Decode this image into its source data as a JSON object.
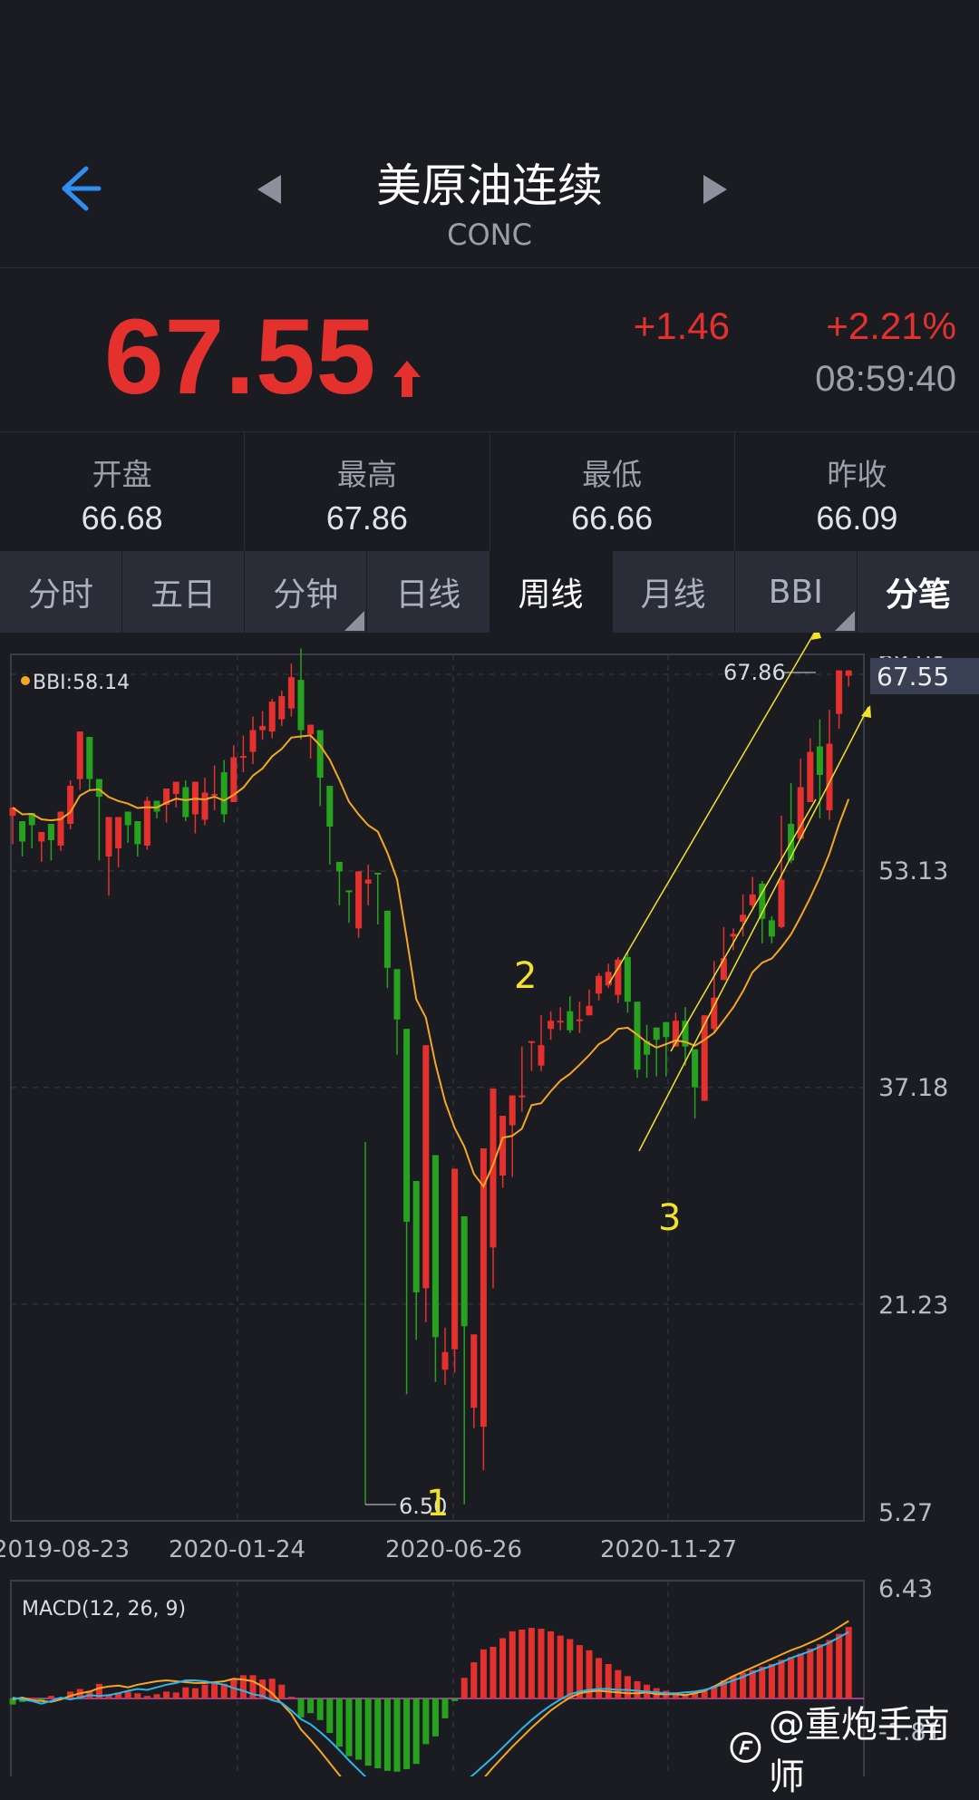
{
  "header": {
    "title": "美原油连续",
    "code": "CONC"
  },
  "quote": {
    "price": "67.55",
    "change": "+1.46",
    "change_pct": "+2.21%",
    "time": "08:59:40"
  },
  "stats": [
    {
      "label": "开盘",
      "value": "66.68"
    },
    {
      "label": "最高",
      "value": "67.86"
    },
    {
      "label": "最低",
      "value": "66.66"
    },
    {
      "label": "昨收",
      "value": "66.09"
    }
  ],
  "tabs": [
    {
      "label": "分时"
    },
    {
      "label": "五日"
    },
    {
      "label": "分钟"
    },
    {
      "label": "日线"
    },
    {
      "label": "周线"
    },
    {
      "label": "月线"
    },
    {
      "label": "BBI"
    },
    {
      "label": "分笔"
    }
  ],
  "colors": {
    "up": "#e5312e",
    "down": "#27a21f",
    "bbi": "#f5a623",
    "background": "#1b1c21"
  },
  "chart_data": [
    {
      "type": "candlestick",
      "indicator_label": "BBI:58.14",
      "y_ticks": [
        "53.13",
        "37.18",
        "21.23",
        "5.27"
      ],
      "y_top_partial": "69.08",
      "ylim": [
        5.27,
        69.08
      ],
      "current_price_tag": "67.55",
      "high_marker": "67.86",
      "low_marker": "6.50",
      "x_ticks": [
        "2019-08-23",
        "2020-01-24",
        "2020-06-26",
        "2020-11-27"
      ],
      "annotations": [
        "1",
        "2",
        "3"
      ],
      "candles": [
        [
          57.2,
          57.8,
          55.4,
          55.1,
          0
        ],
        [
          55.3,
          56.8,
          56.6,
          54.2,
          1
        ],
        [
          56.5,
          57.4,
          55.2,
          54.8,
          1
        ],
        [
          55.3,
          56.0,
          55.4,
          53.8,
          0
        ],
        [
          55.4,
          56.6,
          54.9,
          53.9,
          1
        ],
        [
          55.0,
          57.5,
          56.6,
          54.6,
          0
        ],
        [
          56.6,
          59.4,
          59.8,
          56.2,
          0
        ],
        [
          59.9,
          63.4,
          63.4,
          59.1,
          0
        ],
        [
          63.0,
          59.9,
          58.3,
          59.0,
          1
        ],
        [
          59.9,
          58.6,
          54.1,
          53.9,
          1
        ],
        [
          54.2,
          57.1,
          52.7,
          51.3,
          0
        ],
        [
          54.8,
          57.1,
          52.1,
          53.4,
          0
        ],
        [
          56.5,
          57.5,
          54.3,
          55.2,
          1
        ],
        [
          55.1,
          56.8,
          54.5,
          54.2,
          1
        ],
        [
          55.0,
          58.3,
          58.6,
          54.7,
          0
        ],
        [
          58.3,
          57.5,
          58.2,
          57.0,
          1
        ],
        [
          58.0,
          59.2,
          57.2,
          56.7,
          0
        ],
        [
          58.8,
          59.7,
          59.4,
          57.8,
          0
        ],
        [
          59.3,
          57.1,
          59.8,
          56.8,
          1
        ],
        [
          57.3,
          59.7,
          56.6,
          55.9,
          0
        ],
        [
          56.9,
          58.9,
          60.0,
          56.5,
          0
        ],
        [
          58.8,
          58.8,
          60.9,
          57.6,
          0
        ],
        [
          60.4,
          57.3,
          61.3,
          56.7,
          1
        ],
        [
          58.2,
          61.5,
          62.4,
          58.2,
          0
        ],
        [
          61.6,
          61.5,
          63.1,
          60.4,
          0
        ],
        [
          61.9,
          63.5,
          64.5,
          61.0,
          0
        ],
        [
          63.8,
          63.5,
          64.9,
          62.8,
          0
        ],
        [
          63.4,
          65.6,
          65.8,
          62.9,
          0
        ],
        [
          66.0,
          64.3,
          66.4,
          63.8,
          0
        ],
        [
          65.1,
          67.4,
          68.4,
          64.5,
          0
        ],
        [
          67.2,
          63.5,
          69.5,
          62.8,
          1
        ],
        [
          63.2,
          63.9,
          61.2,
          61.4,
          0
        ],
        [
          63.5,
          60.0,
          59.8,
          57.9,
          1
        ],
        [
          59.4,
          56.4,
          54.0,
          53.6,
          1
        ],
        [
          53.8,
          53.1,
          51.2,
          50.6,
          1
        ],
        [
          51.6,
          51.7,
          49.3,
          49.3,
          1
        ],
        [
          48.9,
          53.1,
          51.9,
          48.2,
          0
        ],
        [
          52.2,
          52.5,
          53.6,
          50.6,
          0
        ],
        [
          53.0,
          52.9,
          50.5,
          49.2,
          1
        ],
        [
          50.2,
          46.0,
          45.8,
          44.5,
          1
        ],
        [
          45.9,
          42.2,
          40.0,
          39.6,
          1
        ],
        [
          41.5,
          27.3,
          30.6,
          14.6,
          1
        ],
        [
          30.3,
          22.1,
          22.2,
          18.6,
          1
        ],
        [
          22.4,
          40.3,
          35.2,
          19.9,
          0
        ],
        [
          32.2,
          18.8,
          17.8,
          15.5,
          1
        ],
        [
          16.4,
          17.7,
          19.5,
          15.3,
          0
        ],
        [
          17.9,
          31.2,
          28.6,
          16.2,
          0
        ],
        [
          27.7,
          19.6,
          17.5,
          6.5,
          1
        ],
        [
          19.0,
          13.6,
          12.0,
          12.1,
          0
        ],
        [
          12.2,
          32.7,
          26.3,
          9.0,
          0
        ],
        [
          25.4,
          37.1,
          31.1,
          22.4,
          0
        ],
        [
          30.7,
          35.1,
          34.2,
          29.8,
          0
        ],
        [
          34.4,
          36.6,
          36.6,
          30.6,
          0
        ],
        [
          36.6,
          36.5,
          40.2,
          35.4,
          0
        ],
        [
          40.5,
          40.6,
          40.0,
          38.4,
          0
        ],
        [
          40.3,
          38.8,
          42.5,
          38.4,
          0
        ],
        [
          42.1,
          41.5,
          42.8,
          40.7,
          0
        ],
        [
          42.1,
          42.1,
          43.1,
          41.4,
          0
        ],
        [
          42.8,
          41.4,
          43.9,
          41.2,
          1
        ],
        [
          42.1,
          42.2,
          43.5,
          41.2,
          0
        ],
        [
          42.5,
          43.2,
          44.4,
          42.8,
          0
        ],
        [
          44.1,
          45.4,
          45.6,
          43.6,
          0
        ],
        [
          45.7,
          44.7,
          46.3,
          44.5,
          0
        ],
        [
          44.0,
          46.6,
          46.8,
          43.4,
          0
        ],
        [
          46.8,
          43.5,
          47.2,
          42.7,
          1
        ],
        [
          43.5,
          38.5,
          40.6,
          37.9,
          1
        ],
        [
          40.6,
          39.6,
          41.8,
          37.9,
          1
        ],
        [
          41.6,
          40.7,
          41.4,
          38.0,
          1
        ],
        [
          42.0,
          40.9,
          40.5,
          38.0,
          1
        ],
        [
          40.2,
          42.1,
          42.7,
          40.3,
          0
        ],
        [
          42.1,
          40.2,
          43.1,
          38.8,
          1
        ],
        [
          40.0,
          37.2,
          36.8,
          34.9,
          1
        ],
        [
          36.2,
          42.5,
          40.8,
          36.7,
          0
        ],
        [
          41.5,
          43.8,
          46.5,
          41.2,
          0
        ],
        [
          46.7,
          45.1,
          49.0,
          45.7,
          0
        ],
        [
          48.3,
          48.5,
          48.9,
          47.3,
          0
        ],
        [
          49.4,
          49.9,
          51.4,
          48.3,
          0
        ],
        [
          51.4,
          50.6,
          52.7,
          50.4,
          0
        ],
        [
          52.2,
          49.6,
          52.4,
          47.8,
          1
        ],
        [
          49.5,
          48.3,
          49.8,
          47.8,
          1
        ],
        [
          49.0,
          52.5,
          57.2,
          48.9,
          0
        ],
        [
          56.6,
          53.9,
          59.6,
          53.7,
          1
        ],
        [
          59.3,
          55.5,
          61.4,
          58.5,
          0
        ],
        [
          61.9,
          58.2,
          62.9,
          60.8,
          0
        ],
        [
          62.3,
          60.2,
          64.3,
          57.0,
          1
        ],
        [
          57.6,
          62.5,
          65.0,
          56.9,
          0
        ],
        [
          64.7,
          67.9,
          67.6,
          63.6,
          0
        ],
        [
          67.5,
          67.9,
          67.6,
          66.7,
          0
        ]
      ],
      "bbi_line": "computed"
    },
    {
      "type": "bar",
      "indicator_label": "MACD(12, 26, 9)",
      "y_ticks": [
        "6.43",
        "-1.81"
      ],
      "series": [
        {
          "name": "MACD",
          "values": [
            -0.7,
            -0.4,
            0.1,
            -0.2,
            0.3,
            0.1,
            0.8,
            1.1,
            0.9,
            1.7,
            0.4,
            0.7,
            0.8,
            0.6,
            0.3,
            0.5,
            0.8,
            0.7,
            1.3,
            1.2,
            1.6,
            1.8,
            1.7,
            2.2,
            2.7,
            2.7,
            2.2,
            2.3,
            1.6,
            0.2,
            -2.2,
            -1.7,
            -2.5,
            -4.0,
            -5.6,
            -6.7,
            -7.1,
            -7.8,
            -8.1,
            -8.4,
            -8.5,
            -8.2,
            -7.6,
            -5.3,
            -4.4,
            -2.3,
            -0.3,
            2.4,
            4.2,
            5.7,
            6.0,
            7.0,
            7.8,
            8.0,
            8.2,
            8.1,
            7.8,
            7.3,
            6.9,
            6.2,
            5.6,
            4.7,
            4.0,
            3.3,
            2.6,
            2.0,
            1.6,
            1.2,
            0.9,
            0.7,
            0.5,
            0.7,
            0.9,
            1.4,
            2.1,
            2.6,
            3.0,
            3.3,
            3.7,
            4.0,
            4.5,
            4.8,
            5.2,
            5.8,
            6.3,
            6.8,
            7.5,
            8.3
          ]
        },
        {
          "name": "DIF",
          "values": [
            -0.1,
            0.1,
            -0.2,
            -0.3,
            -0.4,
            -0.1,
            0.3,
            0.6,
            0.8,
            1.2,
            1.4,
            1.5,
            1.3,
            1.6,
            1.8,
            2.0,
            2.1,
            2.0,
            1.9,
            1.8,
            1.8,
            1.9,
            2.0,
            2.3,
            2.2,
            2.0,
            1.4,
            0.6,
            -0.6,
            -1.8,
            -3.6,
            -4.8,
            -6.1,
            -7.5,
            -8.9,
            -10.5,
            -11.9,
            -13.0,
            -14.0,
            -14.7,
            -15.0,
            -15.2,
            -15.1,
            -14.8,
            -14.2,
            -13.5,
            -12.7,
            -11.7,
            -10.5,
            -9.3,
            -8.0,
            -6.8,
            -5.6,
            -4.5,
            -3.4,
            -2.4,
            -1.4,
            -0.6,
            0.1,
            0.6,
            0.8,
            0.9,
            0.8,
            0.7,
            0.6,
            0.6,
            0.7,
            0.5,
            0.5,
            0.5,
            0.4,
            0.6,
            0.9,
            1.4,
            2.0,
            2.6,
            3.1,
            3.6,
            4.1,
            4.6,
            5.1,
            5.6,
            6.0,
            6.5,
            7.0,
            7.6,
            8.3,
            9.0
          ]
        },
        {
          "name": "DEA",
          "values": [
            0.1,
            -0.1,
            -0.3,
            -0.6,
            -0.3,
            0.1,
            -0.1,
            0.1,
            0.4,
            0.3,
            0.4,
            0.6,
            0.9,
            1.1,
            1.0,
            1.3,
            1.6,
            1.8,
            2.1,
            2.1,
            2.0,
            1.8,
            1.6,
            1.2,
            0.9,
            0.5,
            0.3,
            -0.2,
            -0.5,
            -1.4,
            -2.4,
            -3.0,
            -3.9,
            -4.9,
            -6.0,
            -7.2,
            -8.3,
            -9.4,
            -10.3,
            -11.1,
            -11.6,
            -11.9,
            -12.0,
            -11.9,
            -11.6,
            -11.2,
            -10.5,
            -9.7,
            -8.8,
            -7.8,
            -6.8,
            -5.7,
            -4.6,
            -3.5,
            -2.5,
            -1.6,
            -0.8,
            -0.1,
            0.5,
            0.8,
            1.0,
            1.1,
            1.1,
            1.0,
            1.0,
            0.9,
            0.8,
            0.7,
            0.6,
            0.6,
            0.7,
            0.8,
            1.0,
            1.3,
            1.7,
            2.1,
            2.5,
            3.0,
            3.4,
            3.8,
            4.2,
            4.7,
            5.1,
            5.5,
            6.0,
            6.5,
            7.1,
            7.7
          ]
        }
      ]
    }
  ],
  "watermark": "@重炮手南师"
}
